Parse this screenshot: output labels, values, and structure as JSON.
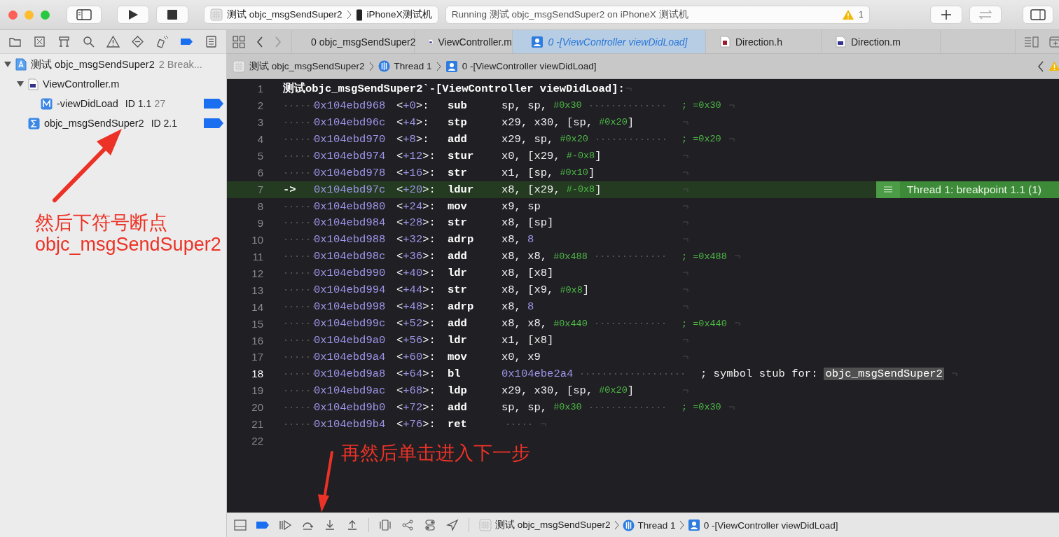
{
  "toolbar": {
    "scheme": "测试 objc_msgSendSuper2",
    "device": "iPhoneX测试机",
    "status": "Running 测试 objc_msgSendSuper2 on iPhoneX 测试机",
    "warning_count": "1"
  },
  "navigator_tabs": [
    {
      "selected": false
    },
    {
      "selected": false
    },
    {
      "selected": false
    },
    {
      "selected": false
    },
    {
      "selected": false
    },
    {
      "selected": false
    },
    {
      "selected": false
    },
    {
      "selected": true
    },
    {
      "selected": false
    }
  ],
  "sidebar": {
    "items": [
      {
        "label": "测试 objc_msgSendSuper2",
        "detail": "2 Break...",
        "kind": "project",
        "expanded": true,
        "children": [
          {
            "label": "ViewController.m",
            "kind": "file",
            "expanded": true,
            "children": [
              {
                "label": "-viewDidLoad",
                "detail": "ID 1.1",
                "line": "27",
                "kind": "method",
                "enabled": true
              }
            ]
          },
          {
            "label": "objc_msgSendSuper2",
            "detail": "ID 2.1",
            "kind": "symbol",
            "enabled": true
          }
        ]
      }
    ]
  },
  "tabs": [
    {
      "label": "0 objc_msgSendSuper2",
      "kind": "doc",
      "selected": false
    },
    {
      "label": "ViewController.m",
      "kind": "m",
      "selected": false
    },
    {
      "label": "0 -[ViewController viewDidLoad]",
      "kind": "frame",
      "selected": true
    },
    {
      "label": "Direction.h",
      "kind": "h",
      "selected": false
    },
    {
      "label": "Direction.m",
      "kind": "m",
      "selected": false
    }
  ],
  "jump_bar": [
    {
      "label": "测试 objc_msgSendSuper2",
      "kind": "process"
    },
    {
      "label": "Thread 1",
      "kind": "thread"
    },
    {
      "label": "0 -[ViewController viewDidLoad]",
      "kind": "frame"
    }
  ],
  "code": {
    "header": "测试objc_msgSendSuper2`-[ViewController viewDidLoad]:",
    "breakpoint_label": "Thread 1: breakpoint 1.1 (1)",
    "lines": [
      {
        "number": "1",
        "kind": "header"
      },
      {
        "number": "2",
        "address": "0x104ebd968",
        "offset": "<+0>:",
        "mnemonic": "sub",
        "operands": [
          {
            "text": "sp, sp,",
            "kind": "reg"
          },
          {
            "text": "#0x30",
            "kind": "imm"
          }
        ],
        "comment": [
          {
            "text": "; =0x30",
            "kind": "imm"
          }
        ]
      },
      {
        "number": "3",
        "address": "0x104ebd96c",
        "offset": "<+4>:",
        "mnemonic": "stp",
        "operands": [
          {
            "text": "x29, x30, [sp,",
            "kind": "reg"
          },
          {
            "text": "#0x20",
            "kind": "imm"
          },
          {
            "text": "]",
            "kind": "reg"
          }
        ]
      },
      {
        "number": "4",
        "address": "0x104ebd970",
        "offset": "<+8>:",
        "mnemonic": "add",
        "operands": [
          {
            "text": "x29, sp,",
            "kind": "reg"
          },
          {
            "text": "#0x20",
            "kind": "imm"
          }
        ],
        "comment": [
          {
            "text": "; =0x20",
            "kind": "imm"
          }
        ]
      },
      {
        "number": "5",
        "address": "0x104ebd974",
        "offset": "<+12>:",
        "mnemonic": "stur",
        "operands": [
          {
            "text": "x0, [x29,",
            "kind": "reg"
          },
          {
            "text": "#-0x8",
            "kind": "imm"
          },
          {
            "text": "]",
            "kind": "reg"
          }
        ]
      },
      {
        "number": "6",
        "address": "0x104ebd978",
        "offset": "<+16>:",
        "mnemonic": "str",
        "operands": [
          {
            "text": "x1, [sp,",
            "kind": "reg"
          },
          {
            "text": "#0x10",
            "kind": "imm"
          },
          {
            "text": "]",
            "kind": "reg"
          }
        ]
      },
      {
        "number": "7",
        "marker": "->",
        "current": true,
        "address": "0x104ebd97c",
        "offset": "<+20>:",
        "mnemonic": "ldur",
        "operands": [
          {
            "text": "x8, [x29,",
            "kind": "reg"
          },
          {
            "text": "#-0x8",
            "kind": "imm"
          },
          {
            "text": "]",
            "kind": "reg"
          }
        ]
      },
      {
        "number": "8",
        "address": "0x104ebd980",
        "offset": "<+24>:",
        "mnemonic": "mov",
        "operands": [
          {
            "text": "x9, sp",
            "kind": "reg"
          }
        ]
      },
      {
        "number": "9",
        "address": "0x104ebd984",
        "offset": "<+28>:",
        "mnemonic": "str",
        "operands": [
          {
            "text": "x8, [sp]",
            "kind": "reg"
          }
        ]
      },
      {
        "number": "10",
        "address": "0x104ebd988",
        "offset": "<+32>:",
        "mnemonic": "adrp",
        "operands": [
          {
            "text": "x8,",
            "kind": "reg"
          },
          {
            "text": "8",
            "kind": "num"
          }
        ]
      },
      {
        "number": "11",
        "address": "0x104ebd98c",
        "offset": "<+36>:",
        "mnemonic": "add",
        "operands": [
          {
            "text": "x8, x8,",
            "kind": "reg"
          },
          {
            "text": "#0x488",
            "kind": "imm"
          }
        ],
        "comment": [
          {
            "text": "; =0x488",
            "kind": "imm"
          }
        ]
      },
      {
        "number": "12",
        "address": "0x104ebd990",
        "offset": "<+40>:",
        "mnemonic": "ldr",
        "operands": [
          {
            "text": "x8, [x8]",
            "kind": "reg"
          }
        ]
      },
      {
        "number": "13",
        "address": "0x104ebd994",
        "offset": "<+44>:",
        "mnemonic": "str",
        "operands": [
          {
            "text": "x8, [x9,",
            "kind": "reg"
          },
          {
            "text": "#0x8",
            "kind": "imm"
          },
          {
            "text": "]",
            "kind": "reg"
          }
        ]
      },
      {
        "number": "14",
        "address": "0x104ebd998",
        "offset": "<+48>:",
        "mnemonic": "adrp",
        "operands": [
          {
            "text": "x8,",
            "kind": "reg"
          },
          {
            "text": "8",
            "kind": "num"
          }
        ]
      },
      {
        "number": "15",
        "address": "0x104ebd99c",
        "offset": "<+52>:",
        "mnemonic": "add",
        "operands": [
          {
            "text": "x8, x8,",
            "kind": "reg"
          },
          {
            "text": "#0x440",
            "kind": "imm"
          }
        ],
        "comment": [
          {
            "text": "; =0x440",
            "kind": "imm"
          }
        ]
      },
      {
        "number": "16",
        "address": "0x104ebd9a0",
        "offset": "<+56>:",
        "mnemonic": "ldr",
        "operands": [
          {
            "text": "x1, [x8]",
            "kind": "reg"
          }
        ]
      },
      {
        "number": "17",
        "address": "0x104ebd9a4",
        "offset": "<+60>:",
        "mnemonic": "mov",
        "operands": [
          {
            "text": "x0, x9",
            "kind": "reg"
          }
        ]
      },
      {
        "number": "18",
        "bright": true,
        "address": "0x104ebd9a8",
        "offset": "<+64>:",
        "mnemonic": "bl",
        "operands": [
          {
            "text": "0x104ebe2a4",
            "kind": "num"
          }
        ],
        "comment": [
          {
            "text": "; symbol stub for:",
            "kind": "reg"
          },
          {
            "text": "objc_msgSendSuper2",
            "kind": "symbol"
          }
        ]
      },
      {
        "number": "19",
        "address": "0x104ebd9ac",
        "offset": "<+68>:",
        "mnemonic": "ldp",
        "operands": [
          {
            "text": "x29, x30, [sp,",
            "kind": "reg"
          },
          {
            "text": "#0x20",
            "kind": "imm"
          },
          {
            "text": "]",
            "kind": "reg"
          }
        ]
      },
      {
        "number": "20",
        "address": "0x104ebd9b0",
        "offset": "<+72>:",
        "mnemonic": "add",
        "operands": [
          {
            "text": "sp, sp,",
            "kind": "reg"
          },
          {
            "text": "#0x30",
            "kind": "imm"
          }
        ],
        "comment": [
          {
            "text": "; =0x30",
            "kind": "imm"
          }
        ]
      },
      {
        "number": "21",
        "address": "0x104ebd9b4",
        "offset": "<+76>:",
        "mnemonic": "ret"
      },
      {
        "number": "22",
        "kind": "empty"
      }
    ]
  },
  "debug_bar": {
    "breakpoints_active": true,
    "path": [
      {
        "label": "测试 objc_msgSendSuper2",
        "kind": "process"
      },
      {
        "label": "Thread 1",
        "kind": "thread"
      },
      {
        "label": "0 -[ViewController viewDidLoad]",
        "kind": "frame"
      }
    ]
  },
  "annotations": [
    {
      "lines": [
        "然后下符号断点",
        "objc_msgSendSuper2"
      ]
    },
    {
      "lines": [
        "再然后单击进入下一步"
      ]
    }
  ]
}
